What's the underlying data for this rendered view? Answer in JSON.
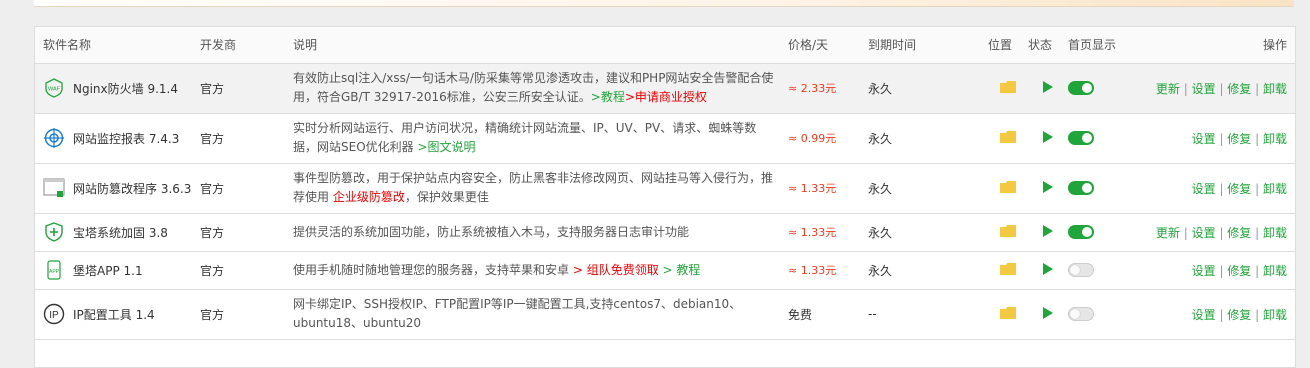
{
  "headers": {
    "name": "软件名称",
    "developer": "开发商",
    "description": "说明",
    "price": "价格/天",
    "expire": "到期时间",
    "location": "位置",
    "status": "状态",
    "home": "首页显示",
    "ops": "操作"
  },
  "rows": [
    {
      "name": "Nginx防火墙 9.1.4",
      "icon": "waf-icon",
      "developer": "官方",
      "desc": "有效防止sql注入/xss/一句话木马/防采集等常见渗透攻击，建议和PHP网站安全告警配合使用，符合GB/T 32917-2016标准，公安三所安全认证。",
      "link_green": ">教程",
      "link_red": ">申请商业授权",
      "price": "≈ 2.33元",
      "expire": "永久",
      "home_on": true,
      "ops": [
        "更新",
        "设置",
        "修复",
        "卸载"
      ]
    },
    {
      "name": "网站监控报表 7.4.3",
      "icon": "monitor-icon",
      "developer": "官方",
      "desc": "实时分析网站运行、用户访问状况，精确统计网站流量、IP、UV、PV、请求、蜘蛛等数据，网站SEO优化利器",
      "link_green": ">图文说明",
      "price": "≈ 0.99元",
      "expire": "永久",
      "home_on": true,
      "ops": [
        "设置",
        "修复",
        "卸载"
      ]
    },
    {
      "name": "网站防篡改程序 3.6.3",
      "icon": "tamper-icon",
      "developer": "官方",
      "desc_a": "事件型防篡改，用于保护站点内容安全，防止黑客非法修改网页、网站挂马等入侵行为，推荐使用",
      "link_red": "企业级防篡改",
      "desc_b": "，保护效果更佳",
      "price": "≈ 1.33元",
      "expire": "永久",
      "home_on": true,
      "ops": [
        "设置",
        "修复",
        "卸载"
      ]
    },
    {
      "name": "宝塔系统加固 3.8",
      "icon": "shield-icon",
      "developer": "官方",
      "desc": "提供灵活的系统加固功能，防止系统被植入木马，支持服务器日志审计功能",
      "price": "≈ 1.33元",
      "expire": "永久",
      "home_on": true,
      "ops": [
        "更新",
        "设置",
        "修复",
        "卸载"
      ]
    },
    {
      "name": "堡塔APP 1.1",
      "icon": "app-icon",
      "developer": "官方",
      "desc": "使用手机随时随地管理您的服务器，支持苹果和安卓",
      "link_red": "> 组队免费领取",
      "link_green": "> 教程",
      "price": "≈ 1.33元",
      "expire": "永久",
      "home_on": false,
      "ops": [
        "设置",
        "修复",
        "卸载"
      ]
    },
    {
      "name": "IP配置工具 1.4",
      "icon": "ip-icon",
      "developer": "官方",
      "desc": "网卡绑定IP、SSH授权IP、FTP配置IP等IP一键配置工具,支持centos7、debian10、ubuntu18、ubuntu20",
      "price": "免费",
      "expire": "--",
      "home_on": false,
      "ops": [
        "设置",
        "修复",
        "卸载"
      ]
    }
  ],
  "colors": {
    "accent": "#20a53a",
    "price": "#f0391d",
    "folder": "#f5c842"
  }
}
